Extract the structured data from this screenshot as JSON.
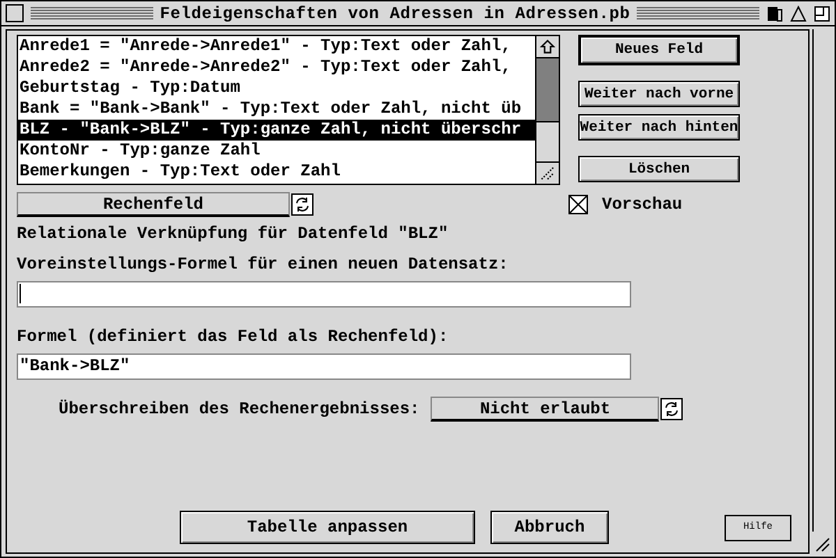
{
  "window": {
    "title": "Feldeigenschaften von Adressen in Adressen.pb"
  },
  "fields_list": {
    "items": [
      {
        "text": "Anrede1 = \"Anrede->Anrede1\" - Typ:Text oder Zahl,",
        "selected": false
      },
      {
        "text": "Anrede2 = \"Anrede->Anrede2\" - Typ:Text oder Zahl,",
        "selected": false
      },
      {
        "text": "Geburtstag - Typ:Datum",
        "selected": false
      },
      {
        "text": "Bank = \"Bank->Bank\" - Typ:Text oder Zahl, nicht üb",
        "selected": false
      },
      {
        "text": "BLZ - \"Bank->BLZ\" - Typ:ganze Zahl, nicht überschr",
        "selected": true
      },
      {
        "text": "KontoNr - Typ:ganze Zahl",
        "selected": false
      },
      {
        "text": "Bemerkungen - Typ:Text oder Zahl",
        "selected": false
      }
    ]
  },
  "side_buttons": [
    {
      "label": "Neues Feld",
      "default": true
    },
    {
      "label": "Weiter nach vorne",
      "default": false
    },
    {
      "label": "Weiter nach hinten",
      "default": false
    },
    {
      "label": "Löschen",
      "default": false
    }
  ],
  "field_type": {
    "value": "Rechenfeld"
  },
  "preview": {
    "label": "Vorschau",
    "checked": true
  },
  "relation_text": "Relationale Verknüpfung für Datenfeld \"BLZ\"",
  "default_formula": {
    "label": "Voreinstellungs-Formel für einen neuen Datensatz:"
  },
  "formula": {
    "label": "Formel (definiert das Feld als Rechenfeld):",
    "value": "\"Bank->BLZ\""
  },
  "overwrite": {
    "label": "Überschreiben des Rechenergebnisses:",
    "value": "Nicht erlaubt"
  },
  "footer_buttons": [
    {
      "label": "Tabelle anpassen"
    },
    {
      "label": "Abbruch"
    }
  ],
  "help_button": {
    "label": "Hilfe"
  }
}
